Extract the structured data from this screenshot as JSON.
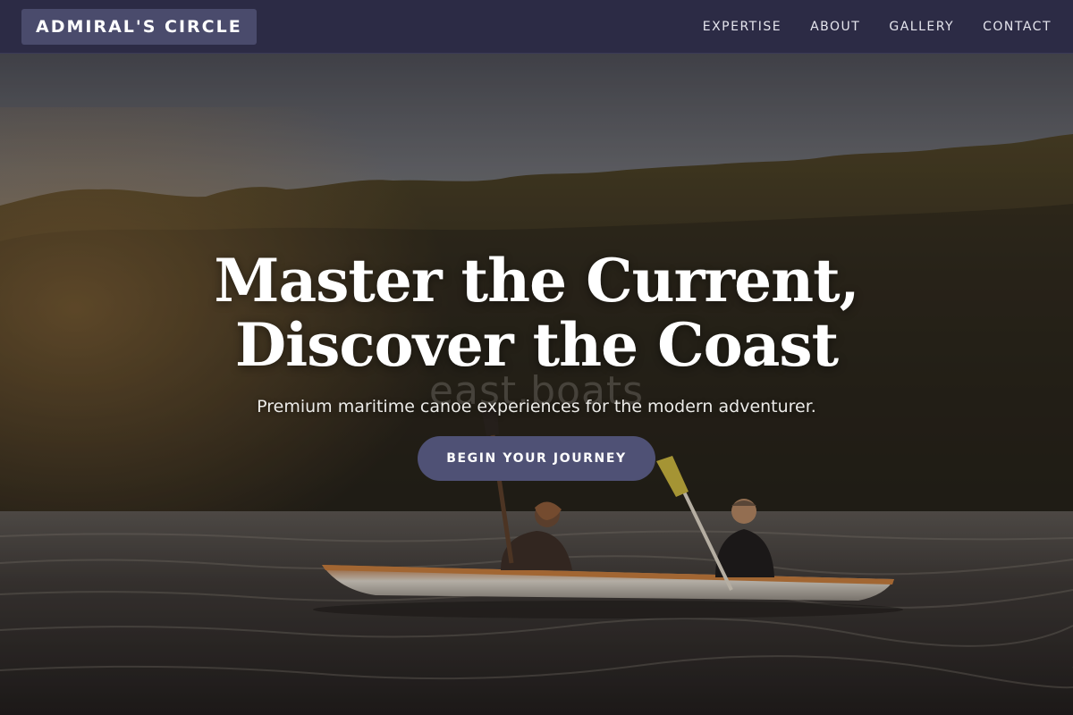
{
  "nav": {
    "brand": "ADMIRAL'S CIRCLE",
    "links": [
      {
        "label": "EXPERTISE"
      },
      {
        "label": "ABOUT"
      },
      {
        "label": "GALLERY"
      },
      {
        "label": "CONTACT"
      }
    ]
  },
  "hero": {
    "title_line_1": "Master the Current,",
    "title_line_2": "Discover the Coast",
    "subtitle": "Premium maritime canoe experiences for the modern adventurer.",
    "cta_label": "BEGIN YOUR JOURNEY",
    "watermark": "east.boats"
  },
  "colors": {
    "navbar": "#2c2b45",
    "brand_bg": "#4a4b6c",
    "cta_bg": "#4f5175",
    "text": "#ffffff"
  }
}
